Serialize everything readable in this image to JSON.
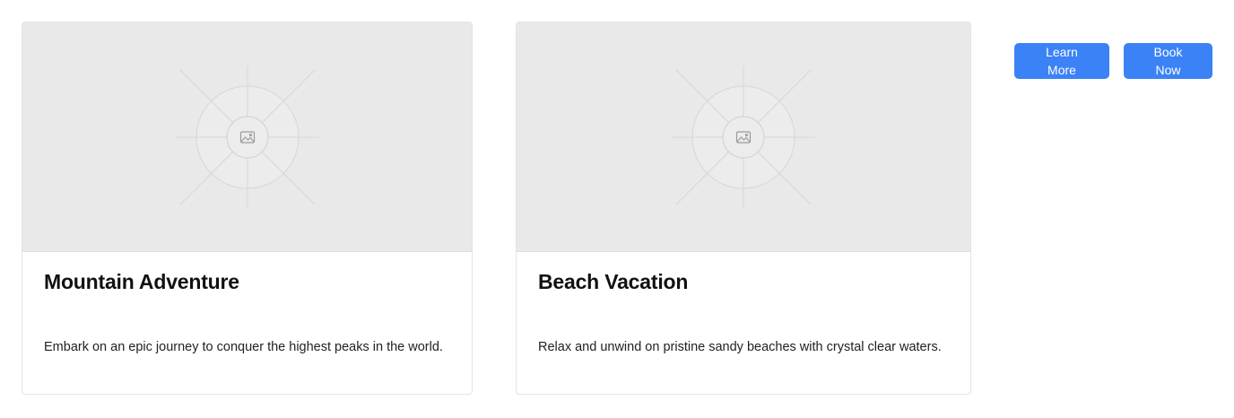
{
  "cards": [
    {
      "image_icon": "image-placeholder-icon",
      "title": "Mountain Adventure",
      "description": "Embark on an epic journey to conquer the highest peaks in the world."
    },
    {
      "image_icon": "image-placeholder-icon",
      "title": "Beach Vacation",
      "description": "Relax and unwind on pristine sandy beaches with crystal clear waters."
    }
  ],
  "actions": {
    "learn_more_line1": "Learn",
    "learn_more_line2": "More",
    "book_now_line1": "Book",
    "book_now_line2": "Now"
  },
  "colors": {
    "button": "#3b82f6",
    "placeholder_bg": "#e9e9e9"
  }
}
